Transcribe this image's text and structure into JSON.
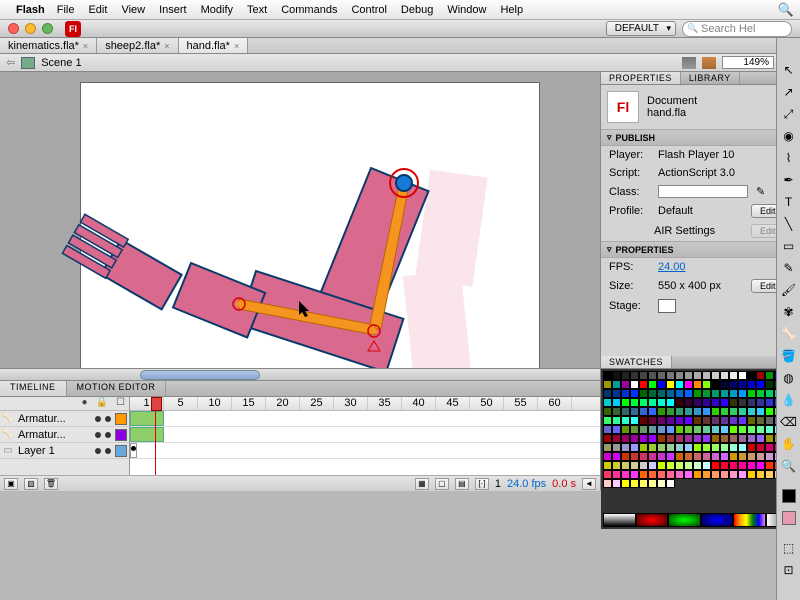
{
  "menubar": {
    "app": "Flash",
    "items": [
      "File",
      "Edit",
      "View",
      "Insert",
      "Modify",
      "Text",
      "Commands",
      "Control",
      "Debug",
      "Window",
      "Help"
    ]
  },
  "workspace": "DEFAULT",
  "search_placeholder": "Search Hel",
  "doc_tabs": [
    {
      "label": "kinematics.fla*"
    },
    {
      "label": "sheep2.fla*"
    },
    {
      "label": "hand.fla*",
      "active": true
    }
  ],
  "editbar": {
    "scene": "Scene 1",
    "zoom": "149%"
  },
  "panels": {
    "properties": "PROPERTIES",
    "library": "LIBRARY",
    "swatches": "SWATCHES",
    "timeline": "TIMELINE",
    "motion_editor": "MOTION EDITOR"
  },
  "properties": {
    "doc_type": "Document",
    "doc_name": "hand.fla",
    "publish_head": "PUBLISH",
    "player_label": "Player:",
    "player_val": "Flash Player 10",
    "script_label": "Script:",
    "script_val": "ActionScript 3.0",
    "class_label": "Class:",
    "class_val": "",
    "profile_label": "Profile:",
    "profile_val": "Default",
    "air_label": "AIR Settings",
    "props_head": "PROPERTIES",
    "fps_label": "FPS:",
    "fps_val": "24.00",
    "size_label": "Size:",
    "size_val": "550 x 400 px",
    "stage_label": "Stage:",
    "edit": "Edit..."
  },
  "timeline": {
    "ruler": [
      "1",
      "5",
      "10",
      "15",
      "20",
      "25",
      "30",
      "35",
      "40",
      "45",
      "50",
      "55",
      "60"
    ],
    "layers": [
      {
        "name": "Armatur...",
        "type": "bone",
        "color": "#f90"
      },
      {
        "name": "Armatur...",
        "type": "bone",
        "color": "#80d"
      },
      {
        "name": "Layer 1",
        "type": "page",
        "color": "#6ad"
      }
    ],
    "footer": {
      "frame_pos": "1",
      "fps": "24.0 fps",
      "time": "0.0 s"
    }
  },
  "tools": [
    "selection",
    "subselect",
    "free-transform",
    "3d-rotate",
    "lasso",
    "pen",
    "text",
    "line",
    "rect",
    "pencil",
    "brush",
    "deco",
    "bone",
    "paint-bucket",
    "ink",
    "eyedrop",
    "eraser",
    "hand",
    "zoom"
  ],
  "tool_colors": {
    "stroke": "#000000",
    "fill": "#e89ab0"
  },
  "chart_data": null
}
